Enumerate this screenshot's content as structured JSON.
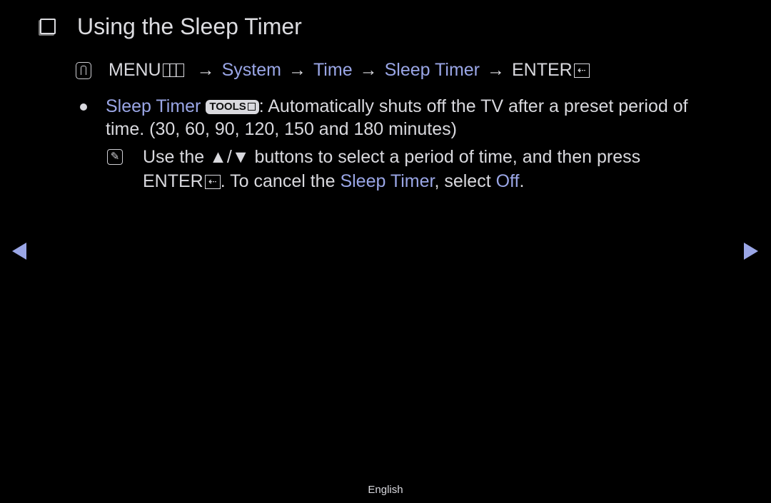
{
  "page": {
    "title": "Using the Sleep Timer",
    "title_icon": "checkbox-icon"
  },
  "path": {
    "icon": "oo-icon",
    "menu_label": "MENU",
    "menu_icon": "menu-grid-icon",
    "arrow": "→",
    "items": [
      "System",
      "Time",
      "Sleep Timer"
    ],
    "enter_label": "ENTER",
    "enter_icon": "enter-icon",
    "enter_glyph": "⇠"
  },
  "bullet": {
    "term": "Sleep Timer",
    "tools_label": "TOOLS",
    "description": ": Automatically shuts off the TV after a preset period of time. (30, 60, 90, 120, 150 and 180 minutes)"
  },
  "note": {
    "icon": "note-icon",
    "icon_glyph": "✎",
    "part1": "Use the ",
    "updown": "▲/▼",
    "part2": " buttons to select a period of time, and then press ",
    "enter_label": "ENTER",
    "enter_glyph": "⇠",
    "part3": ". To cancel the ",
    "term": "Sleep Timer",
    "part4": ", select ",
    "off": "Off",
    "part5": "."
  },
  "navigation": {
    "prev": "previous-page",
    "next": "next-page"
  },
  "footer": {
    "language": "English"
  },
  "colors": {
    "background": "#000000",
    "text": "#d9d9de",
    "accent": "#9aa6e6"
  }
}
